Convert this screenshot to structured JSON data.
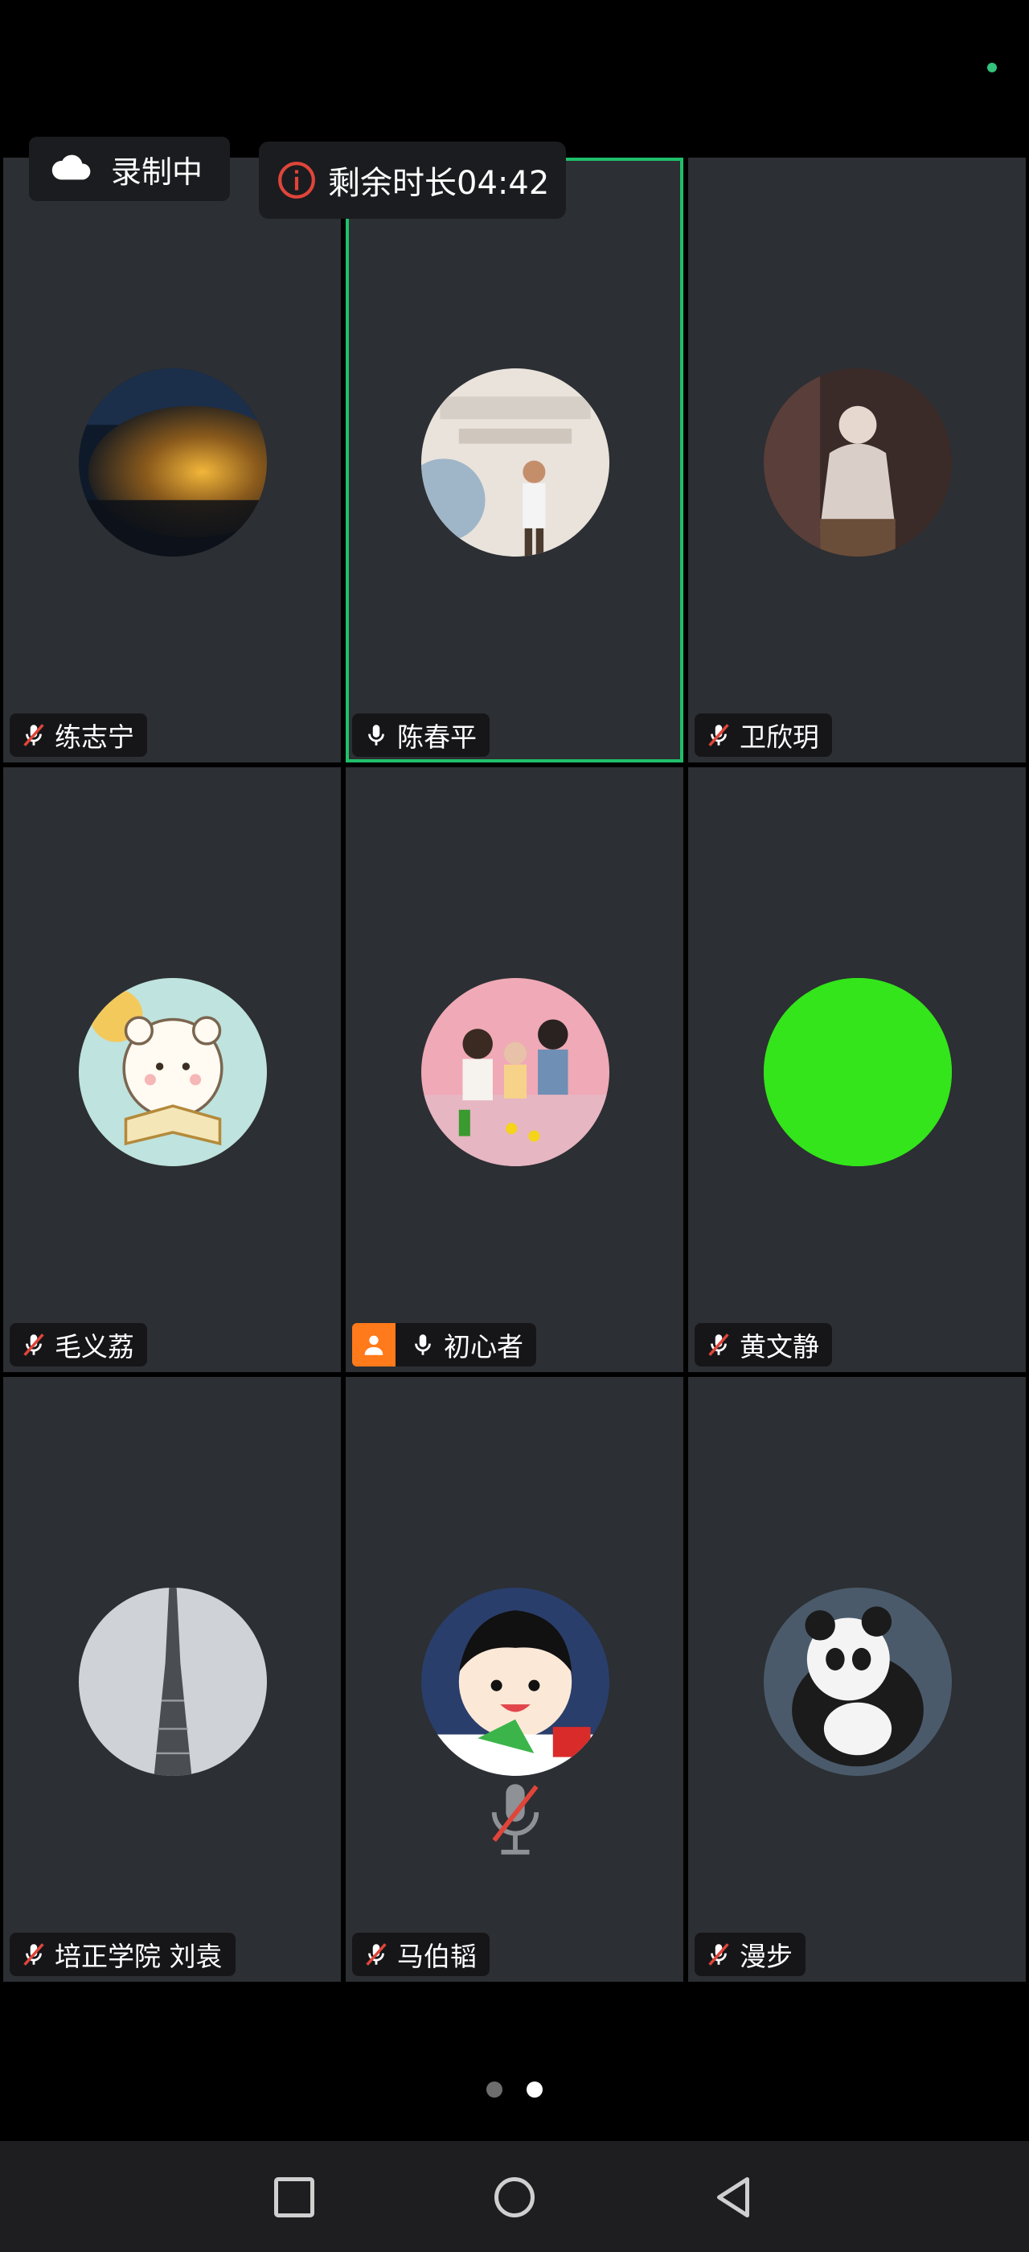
{
  "recording": {
    "label": "录制中"
  },
  "timer": {
    "label": "剩余时长04:42"
  },
  "participants": [
    {
      "name": "练志宁",
      "mic": "muted",
      "avatar": "night-building-photo"
    },
    {
      "name": "陈春平",
      "mic": "on",
      "avatar": "swimming-event-photo",
      "active_speaker": true
    },
    {
      "name": "卫欣玥",
      "mic": "muted",
      "avatar": "woman-photo"
    },
    {
      "name": "毛义荔",
      "mic": "muted",
      "avatar": "cartoon-bear"
    },
    {
      "name": "初心者",
      "mic": "on",
      "host": true,
      "avatar": "family-photo"
    },
    {
      "name": "黄文静",
      "mic": "muted",
      "avatar": "green-circle",
      "avatar_color": "#33e51a"
    },
    {
      "name": "培正学院 刘袁",
      "mic": "muted",
      "avatar": "canton-tower-photo"
    },
    {
      "name": "马伯韬",
      "mic": "muted",
      "avatar": "cartoon-boy",
      "center_muted_icon": true
    },
    {
      "name": "漫步",
      "mic": "muted",
      "avatar": "panda-plush-photo"
    }
  ],
  "pagination": {
    "total": 2,
    "current": 2
  },
  "colors": {
    "active_border": "#1fbf6a",
    "host_badge": "#ff7a1a",
    "muted_slash": "#e0453a",
    "tile_bg": "#2c2f33"
  },
  "icons": {
    "recording": "cloud-icon",
    "timer": "info-icon",
    "mic_on": "mic-icon",
    "mic_muted": "mic-muted-icon",
    "host": "person-icon",
    "nav": [
      "square-icon",
      "circle-icon",
      "triangle-back-icon"
    ]
  }
}
